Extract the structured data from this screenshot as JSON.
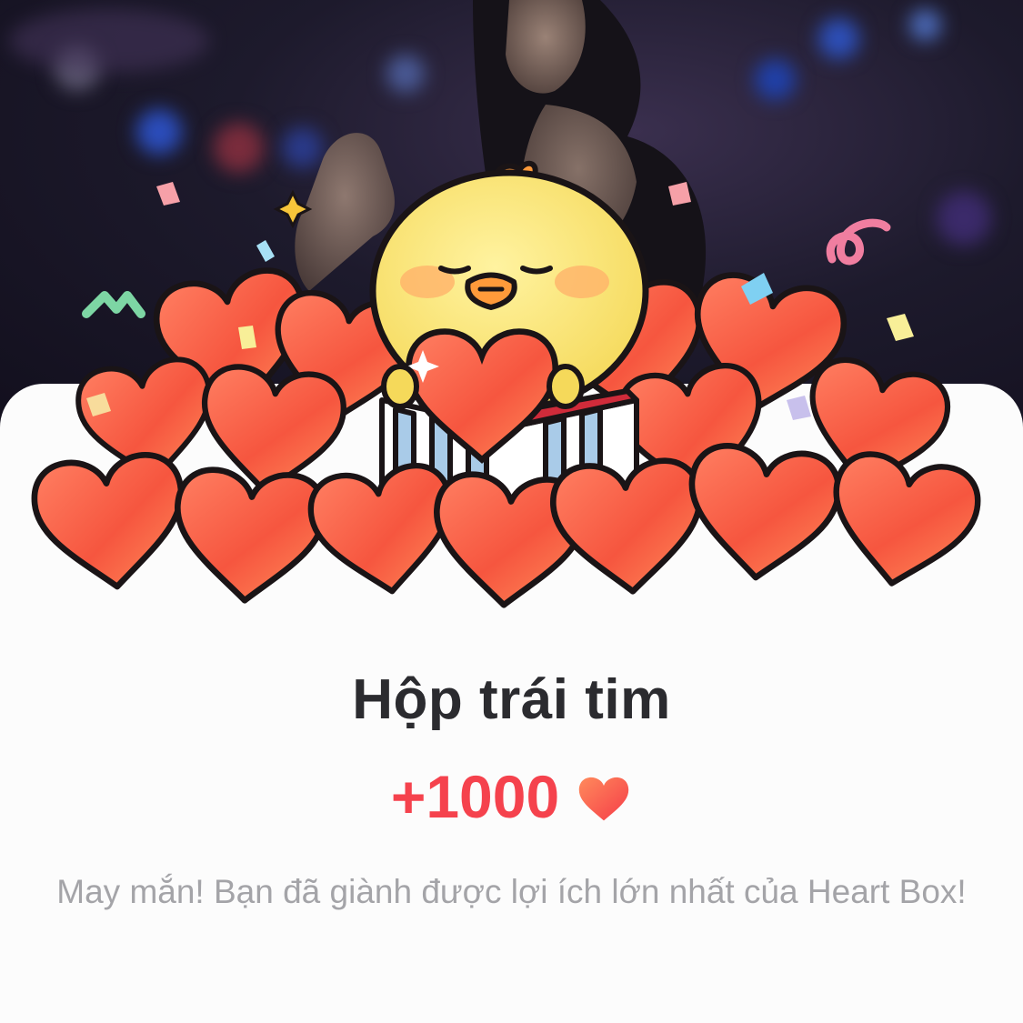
{
  "dialog": {
    "title": "Hộp trái tim",
    "reward_amount": "+1000",
    "reward_icon": "heart-icon",
    "description": "May mắn! Bạn đã giành được lợi ích lớn nhất của Heart Box!"
  },
  "illustration": {
    "subject": "chick-hugging-heart",
    "background": "live-stream-photo"
  },
  "colors": {
    "accent": "#f5424d",
    "title": "#2b2b2f",
    "description": "#a4a4a8",
    "heart_top": "#ff7a5c",
    "heart_bottom": "#ee3b3b",
    "chick": "#f8df6a"
  }
}
